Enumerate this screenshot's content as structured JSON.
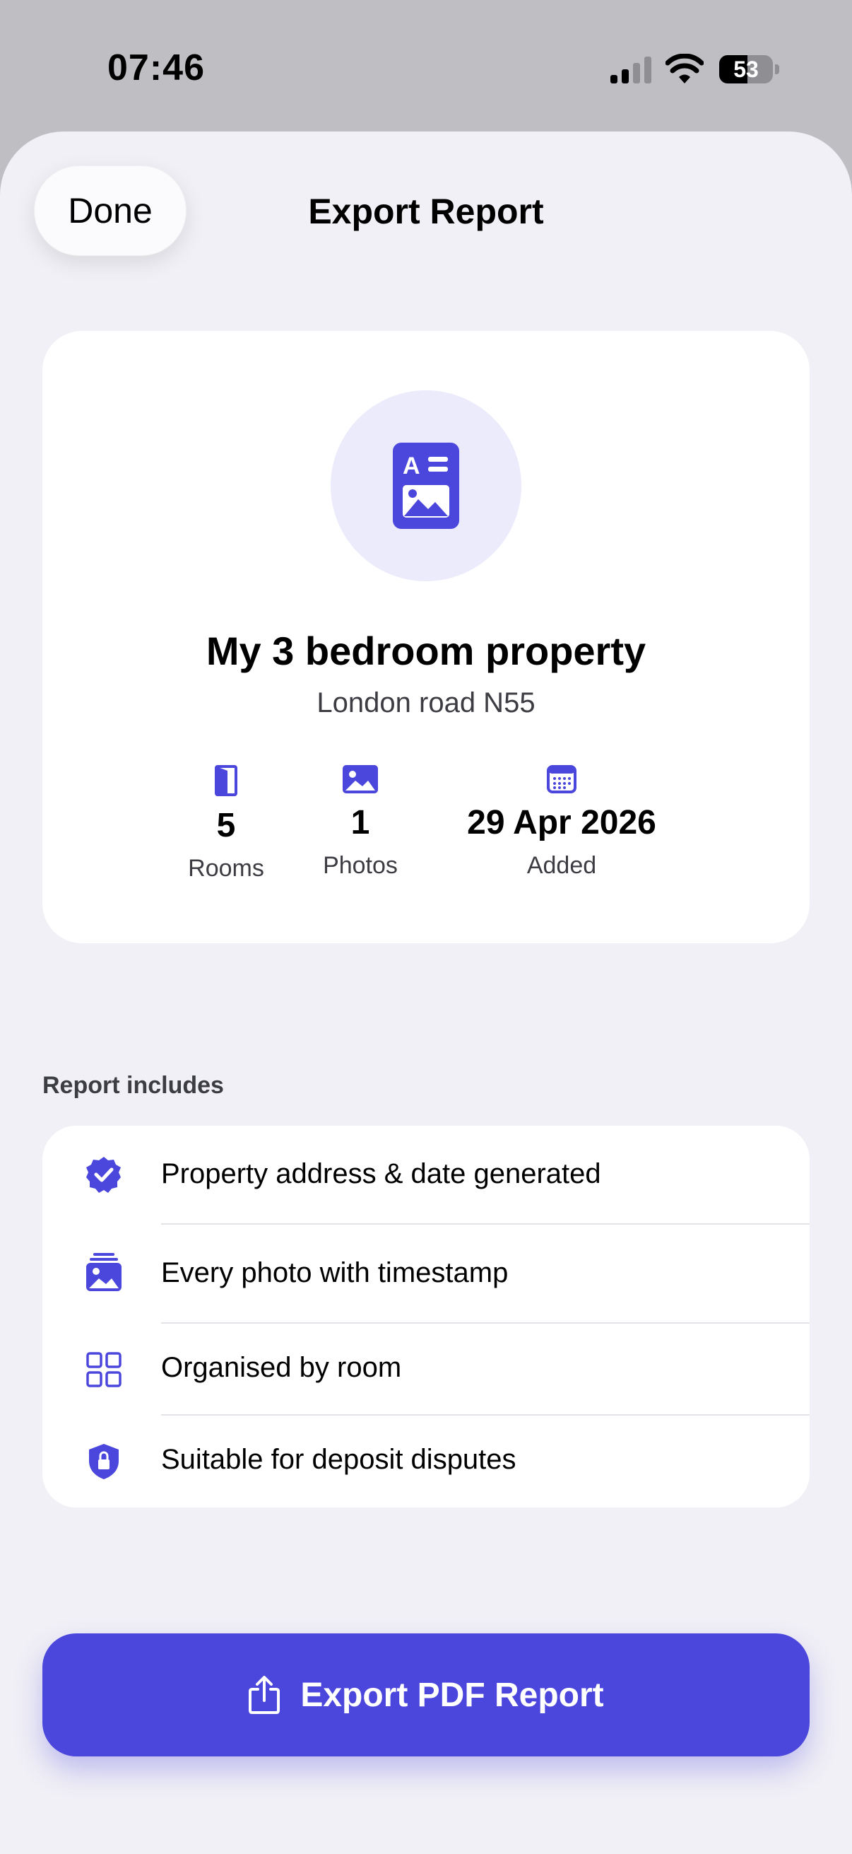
{
  "status_bar": {
    "time": "07:46",
    "battery_percent": "53",
    "battery_level": 53
  },
  "sheet": {
    "done_label": "Done",
    "title": "Export Report"
  },
  "property": {
    "icon": "document-image-icon",
    "name": "My 3 bedroom property",
    "address": "London road N55",
    "stats": [
      {
        "icon": "door-icon",
        "value": "5",
        "label": "Rooms"
      },
      {
        "icon": "photo-icon",
        "value": "1",
        "label": "Photos"
      },
      {
        "icon": "calendar-icon",
        "value": "29 Apr 2026",
        "label": "Added"
      }
    ]
  },
  "report_includes": {
    "header": "Report includes",
    "items": [
      {
        "icon": "verified-badge-icon",
        "label": "Property address & date generated"
      },
      {
        "icon": "photo-stack-icon",
        "label": "Every photo with timestamp"
      },
      {
        "icon": "grid-icon",
        "label": "Organised by room"
      },
      {
        "icon": "shield-lock-icon",
        "label": "Suitable for deposit disputes"
      }
    ]
  },
  "export": {
    "icon": "share-icon",
    "label": "Export PDF Report"
  },
  "colors": {
    "accent": "#4B46DC",
    "accent_light": "#ECEBFC",
    "background": "#F1F0F6"
  }
}
